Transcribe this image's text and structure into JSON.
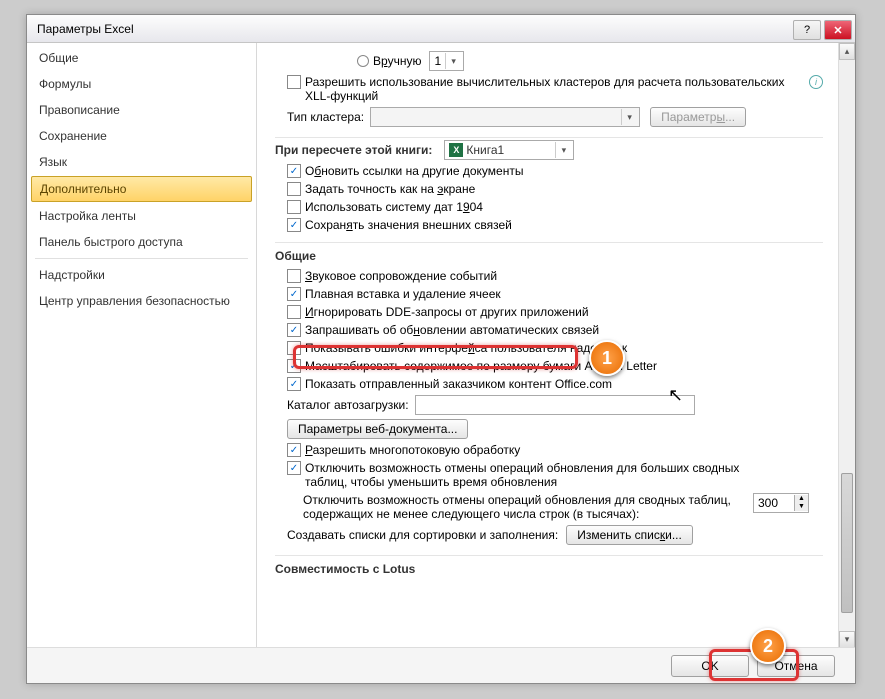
{
  "title": "Параметры Excel",
  "sidebar": {
    "items": [
      {
        "label": "Общие"
      },
      {
        "label": "Формулы"
      },
      {
        "label": "Правописание"
      },
      {
        "label": "Сохранение"
      },
      {
        "label": "Язык"
      },
      {
        "label": "Дополнительно"
      },
      {
        "label": "Настройка ленты"
      },
      {
        "label": "Панель быстрого доступа"
      },
      {
        "label": "Надстройки"
      },
      {
        "label": "Центр управления безопасностью"
      }
    ]
  },
  "calc": {
    "manual": "Вручную",
    "manual_val": "1",
    "allow_clusters": "Разрешить использование вычислительных кластеров для расчета пользовательских XLL-функций",
    "cluster_type": "Тип кластера:",
    "params_btn": "Параметры..."
  },
  "recalc": {
    "heading": "При пересчете этой книги:",
    "book": "Книга1",
    "update_links": "Обновить ссылки на другие документы",
    "set_precision": "Задать точность как на экране",
    "date_1904": "Использовать систему дат 1904",
    "save_ext": "Сохранять значения внешних связей"
  },
  "general": {
    "heading": "Общие",
    "sound": "Звуковое сопровождение событий",
    "smooth_insert": "Плавная вставка и удаление ячеек",
    "ignore_dde": "Игнорировать DDE-запросы от других приложений",
    "ask_update": "Запрашивать об обновлении автоматических связей",
    "addin_errors": "Показывать ошибки интерфейса пользователя надстроек",
    "scale_a4": "Масштабировать содержимое по размеру бумаги A4 или Letter",
    "office_content": "Показать отправленный заказчиком контент Office.com",
    "startup_dir": "Каталог автозагрузки:",
    "web_params": "Параметры веб-документа...",
    "multithread": "Разрешить многопотоковую обработку",
    "disable_undo_large": "Отключить возможность отмены операций обновления для больших сводных таблиц, чтобы уменьшить время обновления",
    "disable_undo_rows": "Отключить возможность отмены операций обновления для сводных таблиц, содержащих не менее следующего числа строк (в тысячах):",
    "rows_val": "300",
    "create_lists": "Создавать списки для сортировки и заполнения:",
    "edit_lists": "Изменить списки..."
  },
  "lotus": {
    "heading": "Совместимость с Lotus"
  },
  "buttons": {
    "ok": "OK",
    "cancel": "Отмена"
  },
  "callouts": {
    "one": "1",
    "two": "2"
  }
}
